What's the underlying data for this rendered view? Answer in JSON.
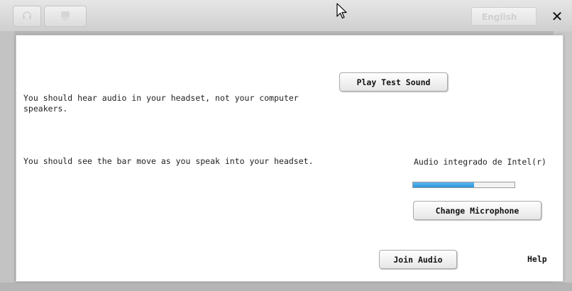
{
  "background": {
    "language_label": "English",
    "close_glyph": "✕"
  },
  "dialog": {
    "speaker_instruction": "You should hear audio in your headset, not your computer speakers.",
    "play_test_sound_label": "Play Test Sound",
    "mic_instruction": "You should see the bar move as you speak into your headset.",
    "microphone_device": "Audio integrado de Intel(r)",
    "mic_level": 0.6,
    "change_microphone_label": "Change Microphone",
    "join_audio_label": "Join Audio",
    "help_label": "Help"
  },
  "colors": {
    "meter_fill": "#2b95dd",
    "dialog_bg": "#ffffff",
    "overlay_bg": "#a8a8a8"
  },
  "icons": {
    "headset": "headset-icon",
    "webcam": "webcam-icon",
    "cursor": "mouse-pointer-icon"
  }
}
